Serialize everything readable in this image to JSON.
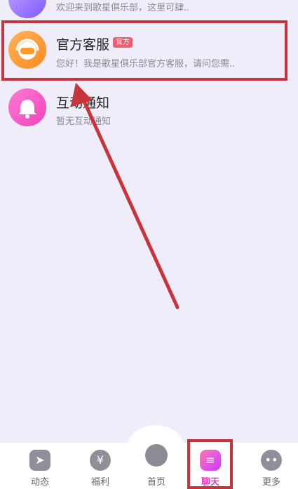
{
  "messages": {
    "top_partial": {
      "subtitle": "欢迎来到歌星俱乐部，这里可肆.."
    },
    "official": {
      "title": "官方客服",
      "badge": "官方",
      "subtitle": "您好！我是歌星俱乐部官方客服，请问您需.."
    },
    "notice": {
      "title": "互动通知",
      "subtitle": "暂无互动通知"
    }
  },
  "bottom_nav": {
    "tabs": [
      {
        "label": "动态"
      },
      {
        "label": "福利"
      },
      {
        "label": "首页"
      },
      {
        "label": "聊天",
        "active": true
      },
      {
        "label": "更多"
      }
    ]
  },
  "colors": {
    "background": "#efedf9",
    "annotation_red": "#c9343a",
    "active_tab": "#e040b6"
  }
}
